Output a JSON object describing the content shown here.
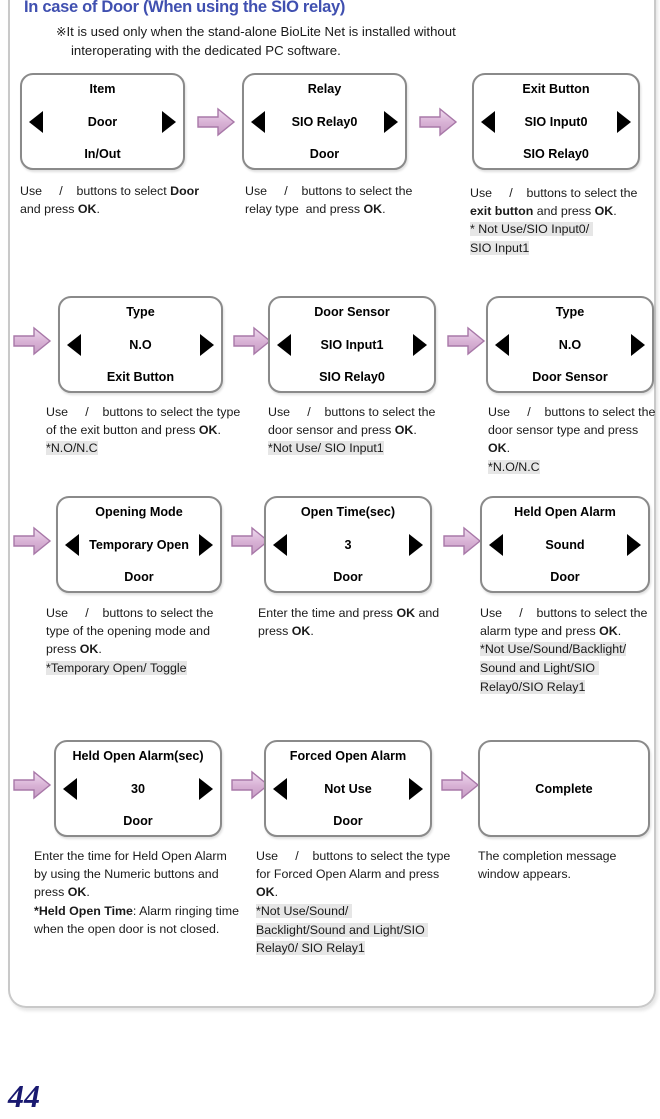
{
  "page": {
    "number": "44",
    "title": "In case of Door (When using the SIO relay)",
    "note_mark": "※",
    "note_line1": "It is used only when the stand-alone BioLite Net is installed without",
    "note_line2": "interoperating with the dedicated PC software."
  },
  "steps": [
    {
      "id": "item-door",
      "screen": {
        "title": "Item",
        "value": "Door",
        "sub": "In/Out"
      },
      "caption_html": "Use&nbsp;&nbsp;&nbsp;&nbsp;&nbsp;/&nbsp;&nbsp;&nbsp;&nbsp;buttons to select <b>Door</b>&nbsp; and press <b>OK</b>.",
      "options": ""
    },
    {
      "id": "relay",
      "screen": {
        "title": "Relay",
        "value": "SIO Relay0",
        "sub": "Door"
      },
      "caption_html": "Use&nbsp;&nbsp;&nbsp;&nbsp;&nbsp;/&nbsp;&nbsp;&nbsp;&nbsp;buttons to select the relay type&nbsp; and press <b>OK</b>.",
      "options": ""
    },
    {
      "id": "exit-button",
      "screen": {
        "title": "Exit Button",
        "value": "SIO Input0",
        "sub": "SIO Relay0"
      },
      "caption_html": "Use&nbsp;&nbsp;&nbsp;&nbsp;&nbsp;/&nbsp;&nbsp;&nbsp;&nbsp;buttons to select the <b>exit button</b> and press <b>OK</b>.",
      "options": "* Not Use/SIO Input0/ |SIO Input1"
    },
    {
      "id": "exit-button-type",
      "screen": {
        "title": "Type",
        "value": "N.O",
        "sub": "Exit Button"
      },
      "caption_html": "Use&nbsp;&nbsp;&nbsp;&nbsp;&nbsp;/&nbsp;&nbsp;&nbsp;&nbsp;buttons to select the type of the exit button and press <b>OK</b>.",
      "options": "*N.O/N.C"
    },
    {
      "id": "door-sensor",
      "screen": {
        "title": "Door Sensor",
        "value": "SIO Input1",
        "sub": "SIO Relay0"
      },
      "caption_html": "Use&nbsp;&nbsp;&nbsp;&nbsp;&nbsp;/&nbsp;&nbsp;&nbsp;&nbsp;buttons to select the door sensor and press <b>OK</b>.",
      "options": "*Not Use/ SIO Input1"
    },
    {
      "id": "door-sensor-type",
      "screen": {
        "title": "Type",
        "value": "N.O",
        "sub": "Door Sensor"
      },
      "caption_html": "Use&nbsp;&nbsp;&nbsp;&nbsp;&nbsp;/&nbsp;&nbsp;&nbsp;&nbsp;buttons to select the door sensor type and press <b>OK</b>.",
      "options": "*N.O/N.C"
    },
    {
      "id": "opening-mode",
      "screen": {
        "title": "Opening Mode",
        "value": "Temporary Open",
        "sub": "Door"
      },
      "caption_html": "Use&nbsp;&nbsp;&nbsp;&nbsp;&nbsp;/&nbsp;&nbsp;&nbsp;&nbsp;buttons to select the type of the opening mode and press <b>OK</b>.",
      "options": "*Temporary Open/ Toggle"
    },
    {
      "id": "open-time",
      "screen": {
        "title": "Open Time(sec)",
        "value": "3",
        "sub": "Door"
      },
      "caption_html": "Enter the time and press <b>OK</b> and press <b>OK</b>.",
      "options": ""
    },
    {
      "id": "held-open-alarm",
      "screen": {
        "title": "Held Open Alarm",
        "value": "Sound",
        "sub": "Door"
      },
      "caption_html": "Use&nbsp;&nbsp;&nbsp;&nbsp;&nbsp;/&nbsp;&nbsp;&nbsp;&nbsp;buttons to select the alarm type and press <b>OK</b>.",
      "options": "*Not Use/Sound/Backlight/|Sound and Light/SIO |Relay0/SIO Relay1"
    },
    {
      "id": "held-open-alarm-sec",
      "screen": {
        "title": "Held Open Alarm(sec)",
        "value": "30",
        "sub": "Door"
      },
      "caption_html": "Enter the time for Held Open Alarm by using the Numeric buttons and press <b>OK</b>.<br><b>*Held Open Time</b>: Alarm ringing time when the open door is not closed.",
      "options": ""
    },
    {
      "id": "forced-open-alarm",
      "screen": {
        "title": "Forced Open Alarm",
        "value": "Not Use",
        "sub": "Door"
      },
      "caption_html": "Use&nbsp;&nbsp;&nbsp;&nbsp;&nbsp;/&nbsp;&nbsp;&nbsp;&nbsp;buttons to select the type for Forced Open Alarm and press <b>OK</b>.",
      "options": "*Not Use/Sound/ |Backlight/Sound and Light/SIO |Relay0/ SIO Relay1"
    },
    {
      "id": "complete",
      "screen": {
        "title": "",
        "value": "Complete",
        "sub": ""
      },
      "caption_html": "The completion message window appears.",
      "options": ""
    }
  ],
  "icons": {
    "arrow_right": "flow-arrow-right-icon",
    "triangle_left": "triangle-left-icon",
    "triangle_right": "triangle-right-icon"
  },
  "colors": {
    "title": "#4050b0",
    "lcd_border": "#8a8a8a",
    "arrow_fill": "#d8b2d8",
    "arrow_stroke": "#a878a8",
    "highlight_bg": "#e6e6e6",
    "page_number": "#191970"
  }
}
